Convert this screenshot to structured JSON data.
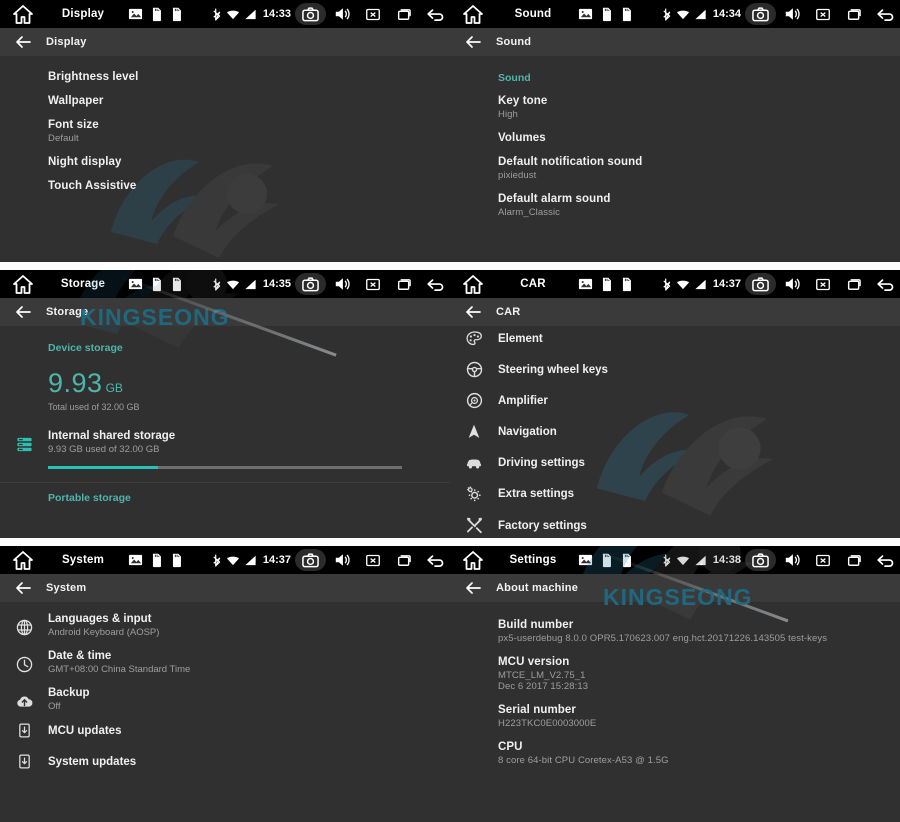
{
  "theme": {
    "panel_bg": "#303030",
    "statusbar_bg": "#000000",
    "actionbar_bg": "#3a3a3a",
    "accent_teal": "#4db6ac",
    "progress_teal": "#26c2b5",
    "text_primary": "#f0f0f0",
    "text_secondary": "#9e9e9e",
    "watermark_blue": "#1f6b84"
  },
  "watermark": {
    "text": "KINGSEONG"
  },
  "statusbar_icons": {
    "home": "home-icon",
    "gallery": "image-icon",
    "sdcard1": "sdcard-icon",
    "sdcard2": "sdcard-icon",
    "bluetooth": "bluetooth-icon",
    "wifi": "wifi-icon",
    "signal": "signal-icon",
    "screenshot": "camera-icon",
    "volume": "volume-icon",
    "close": "close-box-icon",
    "recents": "recents-icon",
    "back": "back-arrow-icon"
  },
  "panels": [
    {
      "id": "display",
      "statusbar": {
        "title": "Display",
        "clock": "14:33"
      },
      "actionbar": {
        "title": "Display"
      },
      "items": [
        {
          "title": "Brightness level",
          "sub": ""
        },
        {
          "title": "Wallpaper",
          "sub": ""
        },
        {
          "title": "Font size",
          "sub": "Default"
        },
        {
          "title": "Night display",
          "sub": ""
        },
        {
          "title": "Touch Assistive",
          "sub": ""
        }
      ]
    },
    {
      "id": "sound",
      "statusbar": {
        "title": "Sound",
        "clock": "14:34"
      },
      "actionbar": {
        "title": "Sound"
      },
      "category": "Sound",
      "items": [
        {
          "title": "Key tone",
          "sub": "High"
        },
        {
          "title": "Volumes",
          "sub": ""
        },
        {
          "title": "Default notification sound",
          "sub": "pixiedust"
        },
        {
          "title": "Default alarm sound",
          "sub": "Alarm_Classic"
        }
      ]
    },
    {
      "id": "storage",
      "statusbar": {
        "title": "Storage",
        "clock": "14:35"
      },
      "actionbar": {
        "title": "Storage"
      },
      "category": "Device storage",
      "total": {
        "value": "9.93",
        "unit": "GB",
        "caption": "Total used of 32.00 GB"
      },
      "entry": {
        "icon": "storage-list-icon",
        "title": "Internal shared storage",
        "sub": "9.93 GB used of 32.00 GB",
        "progress_percent": 31
      },
      "footer_category": "Portable storage"
    },
    {
      "id": "car",
      "statusbar": {
        "title": "CAR",
        "clock": "14:37"
      },
      "actionbar": {
        "title": "CAR"
      },
      "items": [
        {
          "icon": "palette-icon",
          "title": "Element"
        },
        {
          "icon": "steering-wheel-icon",
          "title": "Steering wheel keys"
        },
        {
          "icon": "amplifier-icon",
          "title": "Amplifier"
        },
        {
          "icon": "navigation-arrow-icon",
          "title": "Navigation"
        },
        {
          "icon": "car-icon",
          "title": "Driving settings"
        },
        {
          "icon": "gears-icon",
          "title": "Extra settings"
        },
        {
          "icon": "tools-icon",
          "title": "Factory settings"
        }
      ]
    },
    {
      "id": "system",
      "statusbar": {
        "title": "System",
        "clock": "14:37"
      },
      "actionbar": {
        "title": "System"
      },
      "items": [
        {
          "icon": "globe-icon",
          "title": "Languages & input",
          "sub": "Android Keyboard (AOSP)"
        },
        {
          "icon": "clock-icon",
          "title": "Date & time",
          "sub": "GMT+08:00 China Standard Time"
        },
        {
          "icon": "cloud-upload-icon",
          "title": "Backup",
          "sub": "Off"
        },
        {
          "icon": "device-download-icon",
          "title": "MCU updates",
          "sub": ""
        },
        {
          "icon": "device-download-icon",
          "title": "System updates",
          "sub": ""
        }
      ]
    },
    {
      "id": "about",
      "statusbar": {
        "title": "Settings",
        "clock": "14:38"
      },
      "actionbar": {
        "title": "About machine"
      },
      "items": [
        {
          "title": "Build number",
          "sub": "px5-userdebug 8.0.0 OPR5.170623.007 eng.hct.20171226.143505 test-keys"
        },
        {
          "title": "MCU version",
          "sub": "MTCE_LM_V2.75_1",
          "sub2": "Dec  6 2017 15:28:13"
        },
        {
          "title": "Serial number",
          "sub": "H223TKC0E0003000E"
        },
        {
          "title": "CPU",
          "sub": "8 core 64-bit CPU Coretex-A53 @ 1.5G"
        }
      ]
    }
  ]
}
